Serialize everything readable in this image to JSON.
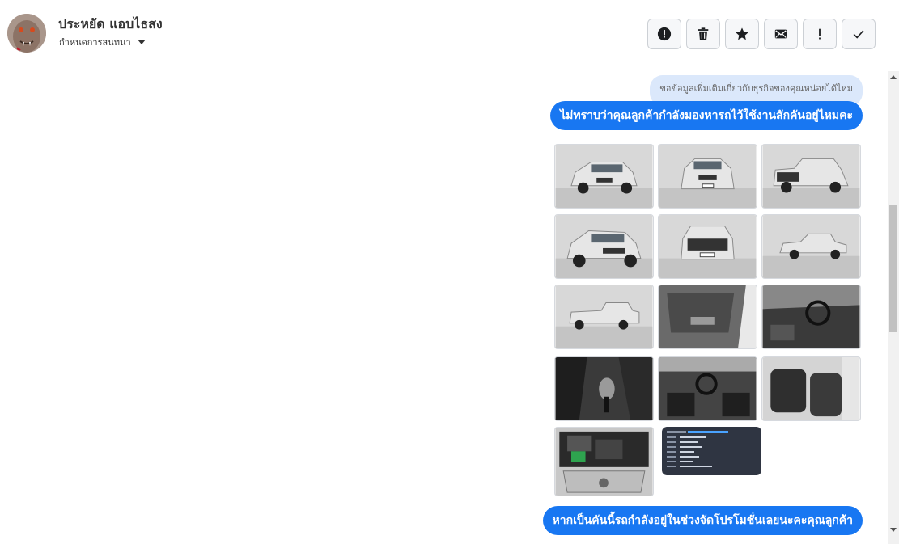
{
  "header": {
    "name": "ประหยัด แอบไธสง",
    "assign_label": "กำหนดการสนทนา"
  },
  "toolbar": [
    {
      "icon": "alert-circle-icon",
      "label": "Report"
    },
    {
      "icon": "trash-icon",
      "label": "Delete"
    },
    {
      "icon": "star-icon",
      "label": "Star"
    },
    {
      "icon": "mail-icon",
      "label": "Mark unread"
    },
    {
      "icon": "exclamation-icon",
      "label": "Important"
    },
    {
      "icon": "check-icon",
      "label": "Done"
    }
  ],
  "messages": {
    "note": "ขอข้อมูลเพิ่มเติมเกี่ยวกับธุรกิจของคุณหน่อยได้ไหม",
    "msg1": "ไม่ทราบว่าคุณลูกค้ากำลังมองหารถไว้ใช้งานสักคันอยู่ไหมคะ",
    "msg2": "หากเป็นคันนี้รถกำลังอยู่ในช่วงจัดโปรโมชั่นเลยนะคะคุณลูกค้า"
  },
  "photos": [
    {
      "kind": "car-front-three-quarter"
    },
    {
      "kind": "car-front"
    },
    {
      "kind": "car-rear-three-quarter"
    },
    {
      "kind": "car-front-three-quarter"
    },
    {
      "kind": "car-rear"
    },
    {
      "kind": "car-side"
    },
    {
      "kind": "car-side"
    },
    {
      "kind": "door-interior"
    },
    {
      "kind": "dashboard"
    },
    {
      "kind": "gear-shift"
    },
    {
      "kind": "dashboard"
    },
    {
      "kind": "rear-seats"
    },
    {
      "kind": "engine-bay"
    },
    {
      "kind": "spec-card"
    }
  ],
  "colors": {
    "accent": "#1877f2",
    "note_bg": "#dbe8fb"
  }
}
